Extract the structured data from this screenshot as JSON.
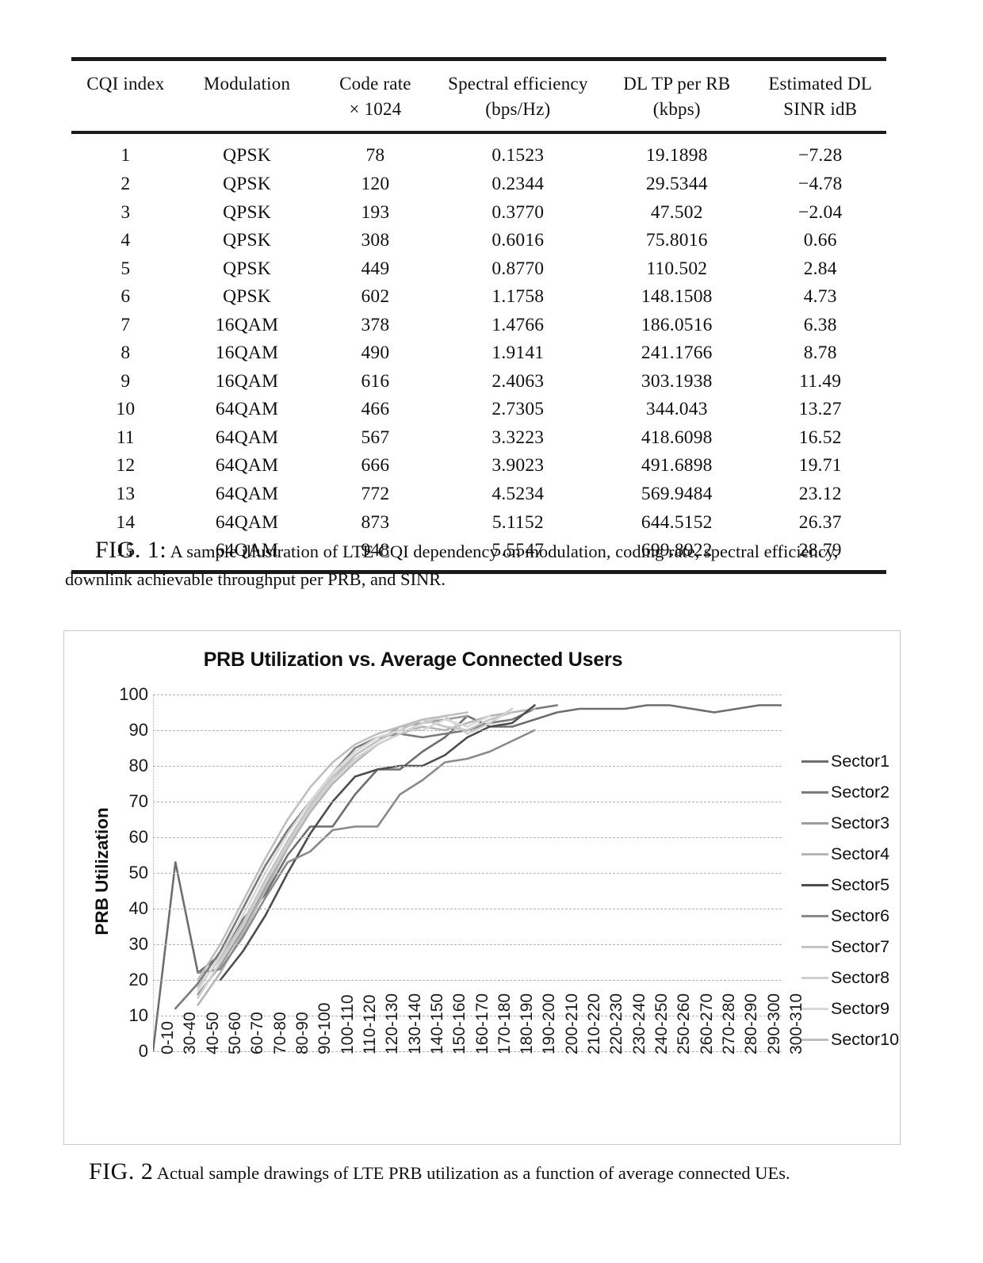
{
  "table": {
    "columns": [
      {
        "line1": "CQI index",
        "line2": ""
      },
      {
        "line1": "Modulation",
        "line2": ""
      },
      {
        "line1": "Code rate",
        "line2": "× 1024"
      },
      {
        "line1": "Spectral efficiency",
        "line2": "(bps/Hz)"
      },
      {
        "line1": "DL TP per RB",
        "line2": "(kbps)"
      },
      {
        "line1": "Estimated DL",
        "line2": "SINR idB"
      }
    ],
    "rows": [
      [
        "1",
        "QPSK",
        "78",
        "0.1523",
        "19.1898",
        "−7.28"
      ],
      [
        "2",
        "QPSK",
        "120",
        "0.2344",
        "29.5344",
        "−4.78"
      ],
      [
        "3",
        "QPSK",
        "193",
        "0.3770",
        "47.502",
        "−2.04"
      ],
      [
        "4",
        "QPSK",
        "308",
        "0.6016",
        "75.8016",
        "0.66"
      ],
      [
        "5",
        "QPSK",
        "449",
        "0.8770",
        "110.502",
        "2.84"
      ],
      [
        "6",
        "QPSK",
        "602",
        "1.1758",
        "148.1508",
        "4.73"
      ],
      [
        "7",
        "16QAM",
        "378",
        "1.4766",
        "186.0516",
        "6.38"
      ],
      [
        "8",
        "16QAM",
        "490",
        "1.9141",
        "241.1766",
        "8.78"
      ],
      [
        "9",
        "16QAM",
        "616",
        "2.4063",
        "303.1938",
        "11.49"
      ],
      [
        "10",
        "64QAM",
        "466",
        "2.7305",
        "344.043",
        "13.27"
      ],
      [
        "11",
        "64QAM",
        "567",
        "3.3223",
        "418.6098",
        "16.52"
      ],
      [
        "12",
        "64QAM",
        "666",
        "3.9023",
        "491.6898",
        "19.71"
      ],
      [
        "13",
        "64QAM",
        "772",
        "4.5234",
        "569.9484",
        "23.12"
      ],
      [
        "14",
        "64QAM",
        "873",
        "5.1152",
        "644.5152",
        "26.37"
      ],
      [
        "15",
        "64QAM",
        "948",
        "5.5547",
        "699.8922",
        "28.79"
      ]
    ]
  },
  "fig1": {
    "label": "FIG. 1:",
    "text": "A sample illustration of LTE CQI dependency on modulation, coding rate, spectral efficiency, downlink achievable throughput per PRB, and SINR."
  },
  "fig2": {
    "label": "FIG. 2",
    "text": "Actual sample drawings of LTE PRB utilization as a function of average connected UEs."
  },
  "chart_data": {
    "type": "line",
    "title": "PRB Utilization vs. Average Connected Users",
    "xlabel": "",
    "ylabel": "PRB Utilization",
    "ylim": [
      0,
      100
    ],
    "ytick_step": 10,
    "yticks": [
      0,
      10,
      20,
      30,
      40,
      50,
      60,
      70,
      80,
      90,
      100
    ],
    "grid": true,
    "legend_position": "right",
    "categories": [
      "0-10",
      "30-40",
      "40-50",
      "50-60",
      "60-70",
      "70-80",
      "80-90",
      "90-100",
      "100-110",
      "110-120",
      "120-130",
      "130-140",
      "140-150",
      "150-160",
      "160-170",
      "170-180",
      "180-190",
      "190-200",
      "200-210",
      "210-220",
      "220-230",
      "230-240",
      "240-250",
      "250-260",
      "260-270",
      "270-280",
      "280-290",
      "290-300",
      "300-310"
    ],
    "series": [
      {
        "name": "Sector1",
        "color": "#6e6e6e",
        "values": [
          0,
          53,
          22,
          27,
          37,
          44,
          55,
          63,
          63,
          72,
          79,
          79,
          84,
          88,
          94,
          91,
          91,
          93,
          95,
          96,
          96,
          96,
          97,
          97,
          96,
          95,
          96,
          97,
          97
        ]
      },
      {
        "name": "Sector2",
        "color": "#7a7a7a",
        "values": [
          null,
          12,
          19,
          28,
          40,
          52,
          62,
          70,
          78,
          85,
          88,
          89,
          88,
          89,
          90,
          92,
          93,
          96,
          97,
          null,
          null,
          null,
          null,
          null,
          null,
          null,
          null,
          null,
          null
        ]
      },
      {
        "name": "Sector3",
        "color": "#9c9c9c",
        "values": [
          null,
          null,
          16,
          24,
          34,
          46,
          58,
          68,
          76,
          83,
          87,
          91,
          92,
          93,
          94,
          null,
          null,
          null,
          null,
          null,
          null,
          null,
          null,
          null,
          null,
          null,
          null,
          null,
          null
        ]
      },
      {
        "name": "Sector4",
        "color": "#b5b5b5",
        "values": [
          null,
          null,
          13,
          22,
          33,
          45,
          57,
          67,
          75,
          81,
          86,
          89,
          91,
          90,
          92,
          94,
          95,
          96,
          null,
          null,
          null,
          null,
          null,
          null,
          null,
          null,
          null,
          null,
          null
        ]
      },
      {
        "name": "Sector5",
        "color": "#4d4d4d",
        "values": [
          null,
          null,
          null,
          20,
          28,
          38,
          50,
          61,
          70,
          77,
          79,
          80,
          80,
          83,
          88,
          91,
          92,
          97,
          null,
          null,
          null,
          null,
          null,
          null,
          null,
          null,
          null,
          null,
          null
        ]
      },
      {
        "name": "Sector6",
        "color": "#8a8a8a",
        "values": [
          null,
          null,
          22,
          23,
          32,
          43,
          53,
          56,
          62,
          63,
          63,
          72,
          76,
          81,
          82,
          84,
          87,
          90,
          null,
          null,
          null,
          null,
          null,
          null,
          null,
          null,
          null,
          null,
          null
        ]
      },
      {
        "name": "Sector7",
        "color": "#c4c4c4",
        "values": [
          null,
          null,
          18,
          26,
          36,
          48,
          59,
          69,
          77,
          83,
          87,
          90,
          93,
          91,
          90,
          93,
          95,
          null,
          null,
          null,
          null,
          null,
          null,
          null,
          null,
          null,
          null,
          null,
          null
        ]
      },
      {
        "name": "Sector8",
        "color": "#cfcfcf",
        "values": [
          null,
          null,
          15,
          25,
          35,
          47,
          58,
          68,
          76,
          82,
          86,
          89,
          92,
          94,
          89,
          92,
          96,
          null,
          null,
          null,
          null,
          null,
          null,
          null,
          null,
          null,
          null,
          null,
          null
        ]
      },
      {
        "name": "Sector9",
        "color": "#d8d8d8",
        "values": [
          null,
          null,
          17,
          27,
          38,
          50,
          61,
          70,
          78,
          84,
          88,
          90,
          90,
          93,
          91,
          94,
          null,
          null,
          null,
          null,
          null,
          null,
          null,
          null,
          null,
          null,
          null,
          null,
          null
        ]
      },
      {
        "name": "Sector10",
        "color": "#bfbfbf",
        "values": [
          null,
          null,
          20,
          30,
          42,
          54,
          65,
          74,
          81,
          86,
          89,
          91,
          93,
          94,
          95,
          null,
          null,
          null,
          null,
          null,
          null,
          null,
          null,
          null,
          null,
          null,
          null,
          null,
          null
        ]
      }
    ]
  }
}
